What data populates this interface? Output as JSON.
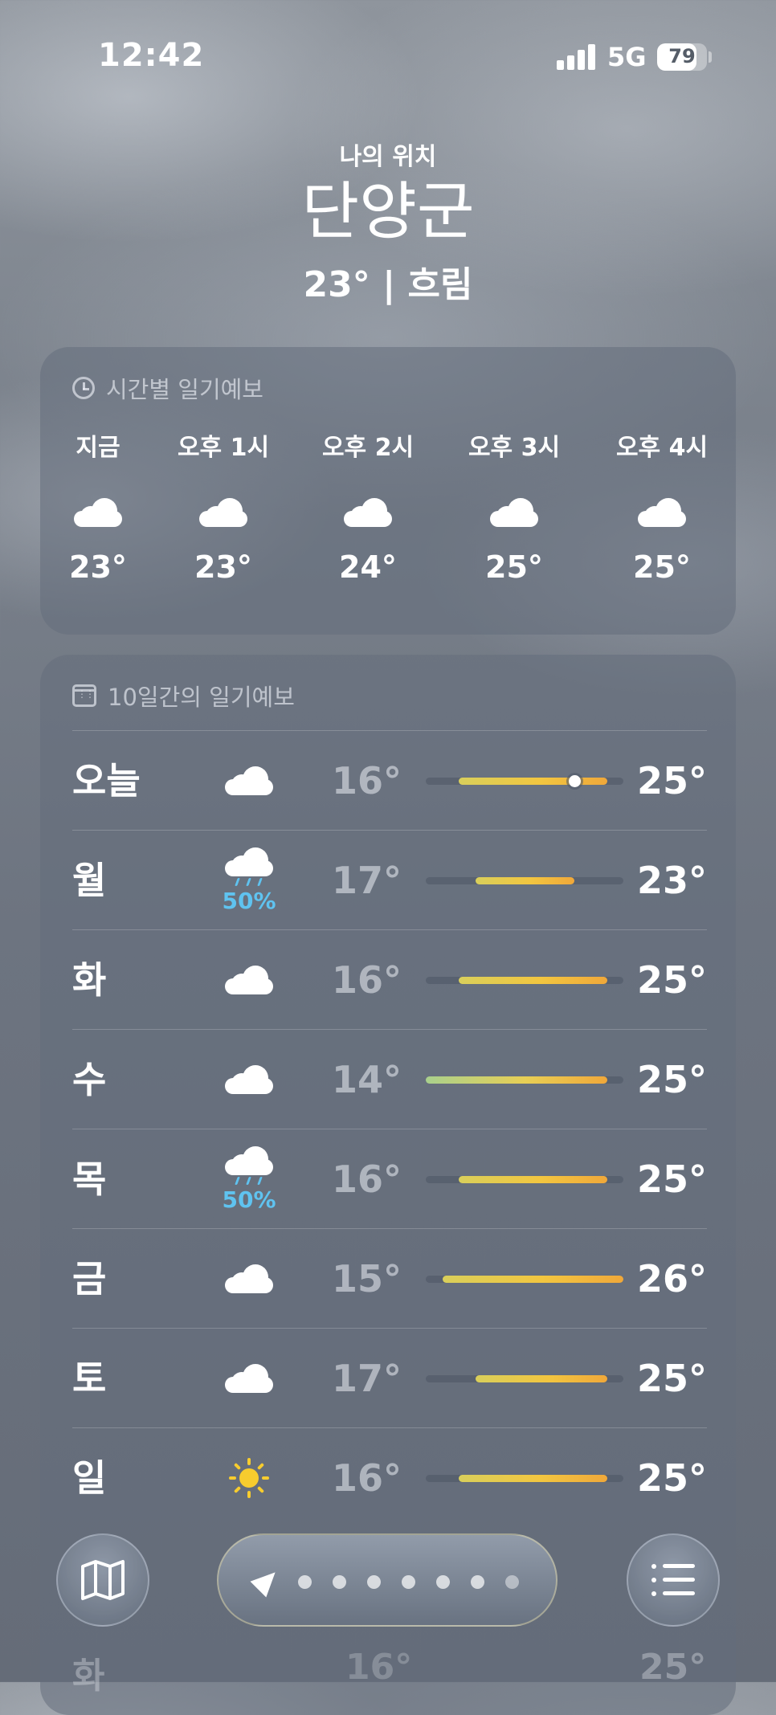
{
  "status_bar": {
    "time": "12:42",
    "network": "5G",
    "battery": "79",
    "battery_level_percent": 79
  },
  "header": {
    "subtitle": "나의 위치",
    "city": "단양군",
    "current": "23° | 흐림"
  },
  "hourly": {
    "title": "시간별 일기예보",
    "icon": "clock-icon",
    "items": [
      {
        "label": "지금",
        "icon": "cloud-icon",
        "temp": "23°"
      },
      {
        "label": "오후 1시",
        "icon": "cloud-icon",
        "temp": "23°"
      },
      {
        "label": "오후 2시",
        "icon": "cloud-icon",
        "temp": "24°"
      },
      {
        "label": "오후 3시",
        "icon": "cloud-icon",
        "temp": "25°"
      },
      {
        "label": "오후 4시",
        "icon": "cloud-icon",
        "temp": "25°"
      }
    ]
  },
  "daily": {
    "title": "10일간의 일기예보",
    "icon": "calendar-icon",
    "scale_min": 14,
    "scale_max": 26,
    "current_temp": 23,
    "days": [
      {
        "day": "오늘",
        "icon": "cloud-icon",
        "low": "16°",
        "high": "25°",
        "low_v": 16,
        "high_v": 25,
        "now": true
      },
      {
        "day": "월",
        "icon": "rain-cloud-icon",
        "pop": "50%",
        "low": "17°",
        "high": "23°",
        "low_v": 17,
        "high_v": 23
      },
      {
        "day": "화",
        "icon": "cloud-icon",
        "low": "16°",
        "high": "25°",
        "low_v": 16,
        "high_v": 25
      },
      {
        "day": "수",
        "icon": "cloud-icon",
        "low": "14°",
        "high": "25°",
        "low_v": 14,
        "high_v": 25
      },
      {
        "day": "목",
        "icon": "rain-cloud-icon",
        "pop": "50%",
        "low": "16°",
        "high": "25°",
        "low_v": 16,
        "high_v": 25
      },
      {
        "day": "금",
        "icon": "cloud-icon",
        "low": "15°",
        "high": "26°",
        "low_v": 15,
        "high_v": 26
      },
      {
        "day": "토",
        "icon": "cloud-icon",
        "low": "17°",
        "high": "25°",
        "low_v": 17,
        "high_v": 25
      },
      {
        "day": "일",
        "icon": "sun-icon",
        "low": "16°",
        "high": "25°",
        "low_v": 16,
        "high_v": 25
      }
    ]
  },
  "toolbar": {
    "map_icon": "map-icon",
    "location_icon": "location-arrow-icon",
    "page_count": 7,
    "list_icon": "list-icon"
  },
  "peek_row": {
    "day": "화",
    "low": "16°",
    "high": "25°"
  }
}
